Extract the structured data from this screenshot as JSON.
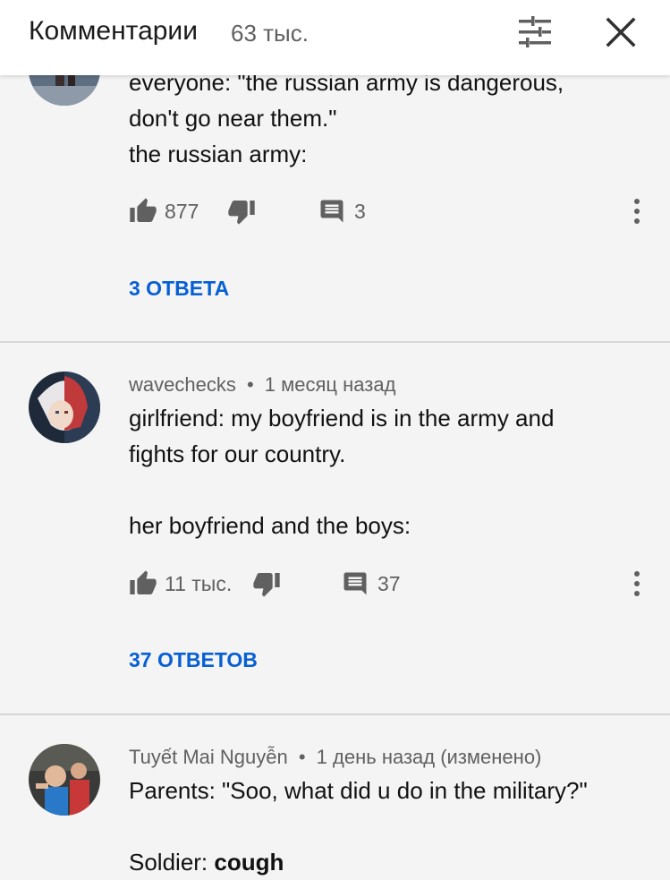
{
  "header": {
    "title": "Комментарии",
    "count": "63 тыс."
  },
  "comments": [
    {
      "lines": [
        "everyone: \"the russian army is dangerous,",
        "don't go near them.\"",
        "the russian army:"
      ],
      "likes": "877",
      "reply_count": "3",
      "replies_link": "3 ОТВЕТА"
    },
    {
      "author": "wavechecks",
      "time": "1 месяц назад",
      "lines": [
        "girlfriend: my boyfriend is in the army and",
        "fights for our country.",
        "",
        "her boyfriend and the boys:"
      ],
      "likes": "11 тыс.",
      "reply_count": "37",
      "replies_link": "37 ОТВЕТОВ"
    },
    {
      "author": "Tuyết Mai Nguyễn",
      "time": "1 день назад (изменено)",
      "lines": [
        "Parents: \"Soo, what did u do in the military?\"",
        ""
      ],
      "last_line_prefix": "Soldier: ",
      "last_line_bold": "cough"
    }
  ],
  "separator": "•",
  "icons": {
    "sort": "sort-icon",
    "close": "close-icon",
    "like": "thumb-up-icon",
    "dislike": "thumb-down-icon",
    "reply": "comment-icon",
    "more": "more-vert-icon"
  },
  "colors": {
    "background": "#f4f4f4",
    "header": "#ffffff",
    "link": "#065fd4",
    "secondary_text": "#606060"
  }
}
